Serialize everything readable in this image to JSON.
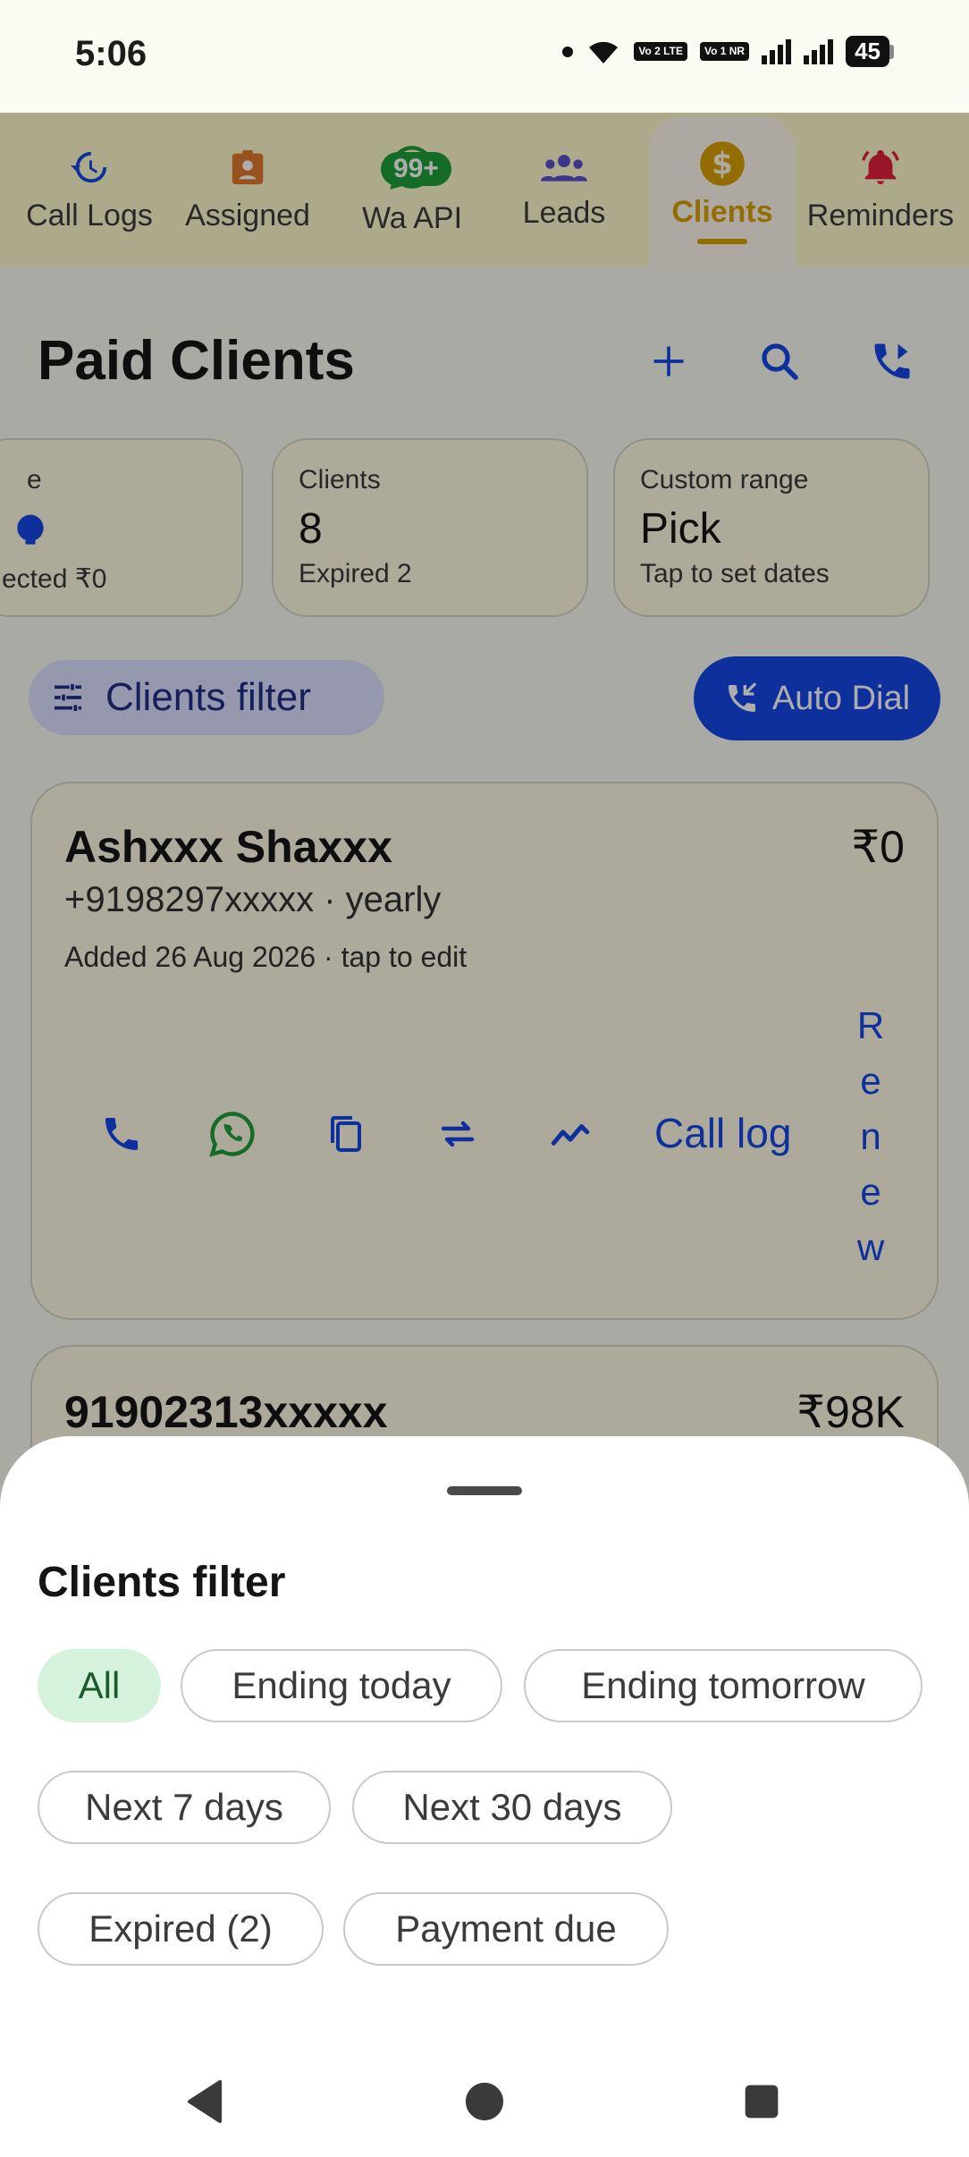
{
  "status": {
    "time": "5:06",
    "battery": "45",
    "sim1": "Vo 2 LTE",
    "sim2": "Vo 1 NR"
  },
  "tabs": [
    {
      "label": "Call Logs",
      "icon": "history-icon"
    },
    {
      "label": "Assigned",
      "icon": "badge-icon"
    },
    {
      "label": "Wa API",
      "icon": "whatsapp-icon",
      "badge": "99+"
    },
    {
      "label": "Leads",
      "icon": "group-icon"
    },
    {
      "label": "Clients",
      "icon": "dollar-icon",
      "active": true
    },
    {
      "label": "Reminders",
      "icon": "bell-icon"
    }
  ],
  "header": {
    "title": "Paid Clients"
  },
  "summary": {
    "card1": {
      "label": "e",
      "sub": "ected ₹0"
    },
    "card2": {
      "label": "Clients",
      "value": "8",
      "sub": "Expired 2"
    },
    "card3": {
      "label": "Custom range",
      "value": "Pick",
      "sub": "Tap to set dates"
    }
  },
  "filter_button": {
    "label": "Clients filter"
  },
  "auto_dial": {
    "label": "Auto Dial"
  },
  "clients": [
    {
      "name": "Ashxxx Shaxxx",
      "amount": "₹0",
      "phone": "+9198297xxxxx · yearly",
      "added": "Added 26 Aug 2026 · tap to edit",
      "call_log": "Call log",
      "renew": [
        "R",
        "e",
        "n",
        "e",
        "w"
      ]
    },
    {
      "name": "91902313xxxxx",
      "amount": "₹98K"
    }
  ],
  "sheet": {
    "title": "Clients filter",
    "chips": [
      "All",
      "Ending today",
      "Ending tomorrow",
      "Next 7 days",
      "Next 30 days",
      "Expired (2)",
      "Payment due"
    ],
    "selected": "All"
  },
  "colors": {
    "primary": "#1447e6",
    "clients_accent": "#d9a100",
    "whatsapp": "#1fa03a",
    "reminder": "#e0213a"
  }
}
